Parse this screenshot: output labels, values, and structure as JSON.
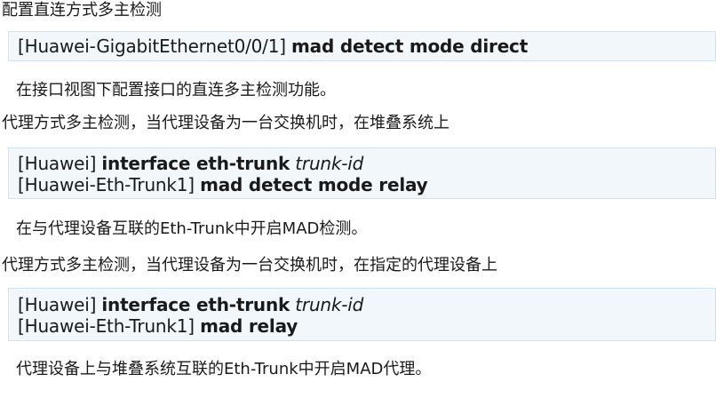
{
  "sections": [
    {
      "heading": "配置直连方式多主检测",
      "code": [
        {
          "prompt": "[Huawei-GigabitEthernet0/0/1]",
          "command": "mad  detect  mode  direct",
          "arg": ""
        }
      ],
      "description": "在接口视图下配置接口的直连多主检测功能。"
    },
    {
      "heading": "代理方式多主检测，当代理设备为一台交换机时，在堆叠系统上",
      "code": [
        {
          "prompt": "[Huawei]",
          "command": "interface  eth-trunk",
          "arg": "trunk-id"
        },
        {
          "prompt": "[Huawei-Eth-Trunk1]",
          "command": "mad  detect  mode  relay",
          "arg": ""
        }
      ],
      "description": "在与代理设备互联的Eth-Trunk中开启MAD检测。"
    },
    {
      "heading": "代理方式多主检测，当代理设备为一台交换机时，在指定的代理设备上",
      "code": [
        {
          "prompt": "[Huawei]",
          "command": "interface  eth-trunk",
          "arg": "trunk-id"
        },
        {
          "prompt": "[Huawei-Eth-Trunk1]",
          "command": "mad  relay",
          "arg": ""
        }
      ],
      "description": "代理设备上与堆叠系统互联的Eth-Trunk中开启MAD代理。"
    }
  ]
}
